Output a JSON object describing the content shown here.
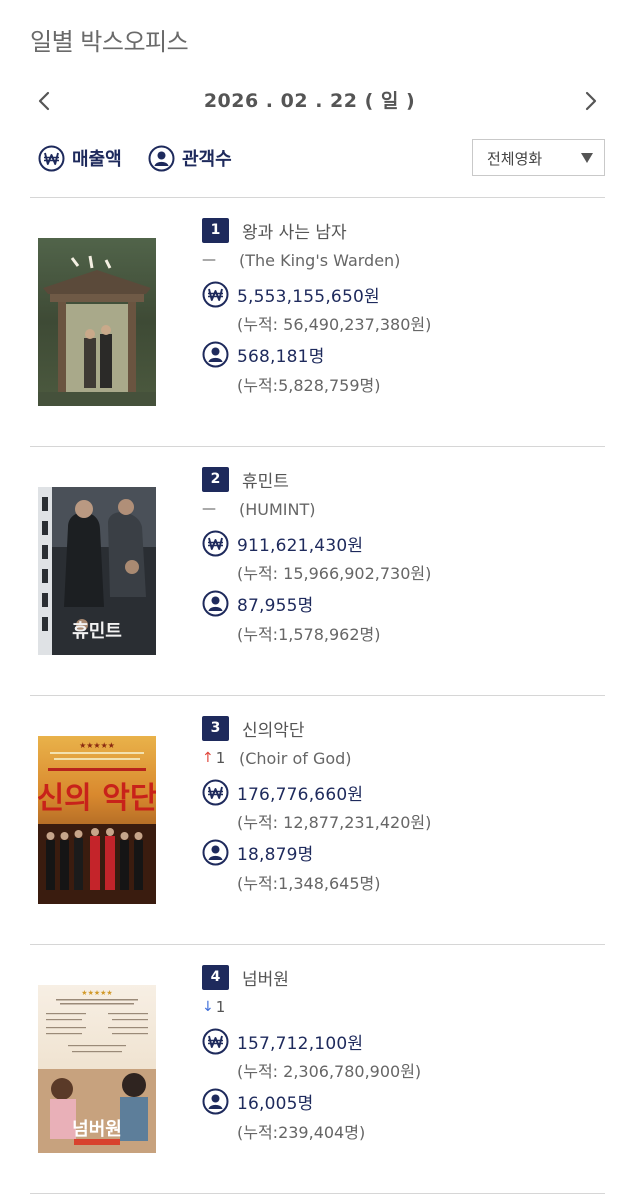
{
  "page": {
    "title": "일별 박스오피스",
    "date": "2026 . 02 . 22 ( 일 )"
  },
  "toggles": {
    "sales_label": "매출액",
    "audience_label": "관객수"
  },
  "filter": {
    "selected": "전체영화"
  },
  "movies": [
    {
      "rank": "1",
      "title": "왕과 사는 남자",
      "change_symbol": "—",
      "change_dir": "none",
      "change_value": "",
      "en_title": "(The King's Warden)",
      "sales": "5,553,155,650원",
      "sales_cum": "(누적: 56,490,237,380원)",
      "audience": "568,181명",
      "audience_cum": "(누적:5,828,759명)"
    },
    {
      "rank": "2",
      "title": "휴민트",
      "change_symbol": "—",
      "change_dir": "none",
      "change_value": "",
      "en_title": "(HUMINT)",
      "sales": "911,621,430원",
      "sales_cum": "(누적: 15,966,902,730원)",
      "audience": "87,955명",
      "audience_cum": "(누적:1,578,962명)"
    },
    {
      "rank": "3",
      "title": "신의악단",
      "change_symbol": "↑",
      "change_dir": "up",
      "change_value": "1",
      "en_title": "(Choir of God)",
      "sales": "176,776,660원",
      "sales_cum": "(누적: 12,877,231,420원)",
      "audience": "18,879명",
      "audience_cum": "(누적:1,348,645명)"
    },
    {
      "rank": "4",
      "title": "넘버원",
      "change_symbol": "↓",
      "change_dir": "down",
      "change_value": "1",
      "en_title": "",
      "sales": "157,712,100원",
      "sales_cum": "(누적: 2,306,780,900원)",
      "audience": "16,005명",
      "audience_cum": "(누적:239,404명)"
    }
  ],
  "colors": {
    "accent": "#1e2a5c",
    "up": "#e0453a",
    "down": "#3f6fd9",
    "divider": "#d6d6d6"
  }
}
